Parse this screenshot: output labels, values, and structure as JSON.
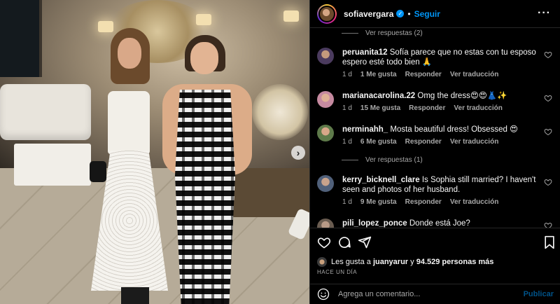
{
  "header": {
    "username": "sofiavergara",
    "separator": "•",
    "follow_label": "Seguir",
    "more_label": "···"
  },
  "comments": {
    "top_replies_label": "Ver respuestas (2)",
    "items": [
      {
        "user": "peruanita12",
        "text": "Sofía parece que no estas con tu esposo espero esté todo bien 🙏",
        "time": "1 d",
        "likes": "1 Me gusta",
        "reply": "Responder",
        "translate": "Ver traducción"
      },
      {
        "user": "marianacarolina.22",
        "text": "Omg the dress😍😍👗✨",
        "time": "1 d",
        "likes": "15 Me gusta",
        "reply": "Responder",
        "translate": "Ver traducción"
      },
      {
        "user": "nerminahh_",
        "text": "Mosta beautiful dress! Obsessed 😍",
        "time": "1 d",
        "likes": "6 Me gusta",
        "reply": "Responder",
        "translate": "Ver traducción"
      },
      {
        "user": "kerry_bicknell_clare",
        "text": "Is Sophia still married? I haven't seen and photos of her husband.",
        "time": "1 d",
        "likes": "9 Me gusta",
        "reply": "Responder",
        "translate": "Ver traducción"
      },
      {
        "user": "pili_lopez_ponce",
        "text": "Donde está Joe?"
      }
    ],
    "mid_replies_label": "Ver respuestas (1)"
  },
  "likes_bar": {
    "prefix": "Les gusta a",
    "user": "juanyarur",
    "connector": "y",
    "others": "94.529 personas más"
  },
  "timeago": "HACE UN DÍA",
  "composer": {
    "placeholder": "Agrega un comentario...",
    "post_label": "Publicar"
  },
  "colors": {
    "accent": "#0095f6",
    "muted": "#a8a8a8",
    "border": "#262626",
    "background": "#000000"
  }
}
